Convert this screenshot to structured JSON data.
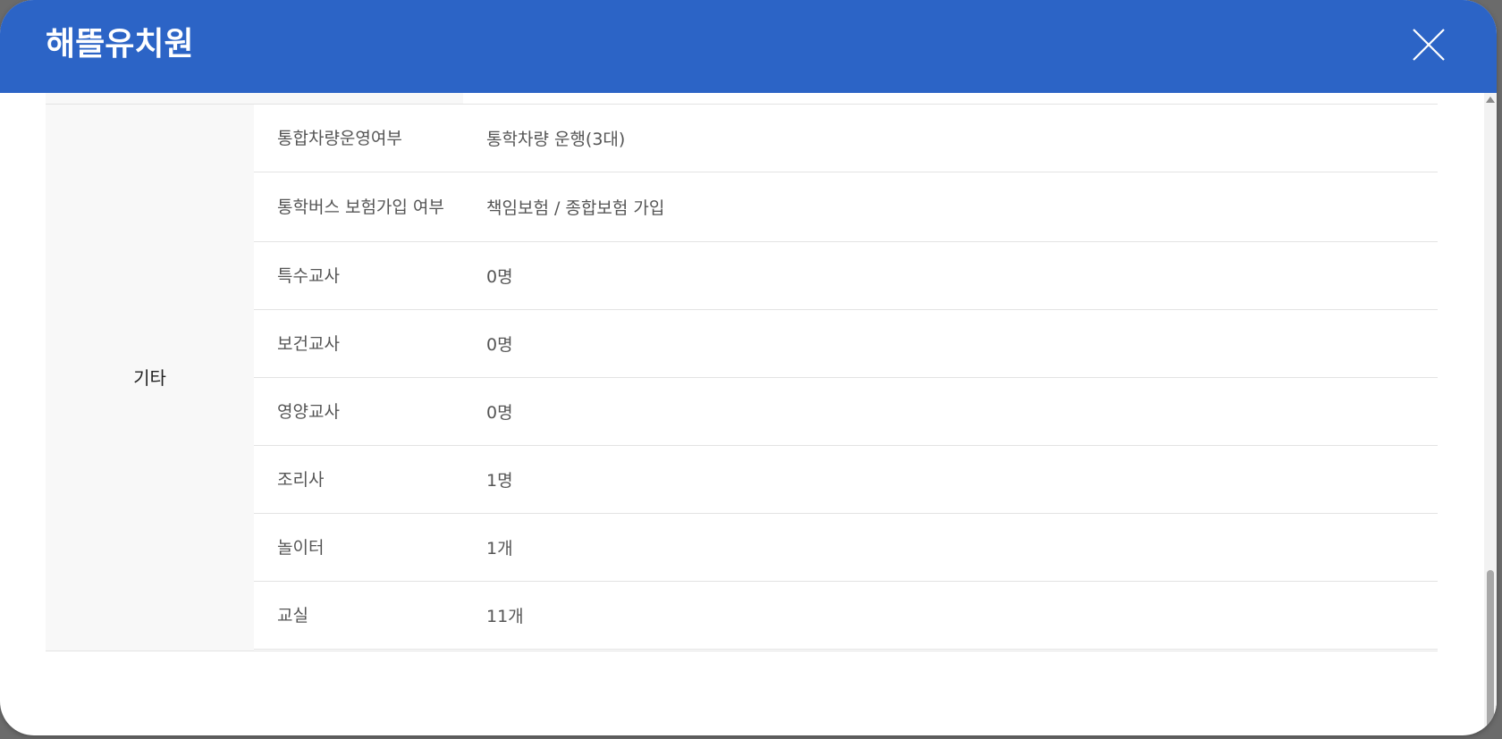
{
  "modal": {
    "title": "해뜰유치원",
    "close_icon": "close-icon",
    "header_color": "#2c64c6"
  },
  "section": {
    "group_label": "기타",
    "rows": [
      {
        "label": "통합차량운영여부",
        "value": "통학차량 운행(3대)"
      },
      {
        "label": "통학버스 보험가입 여부",
        "value": "책임보험 / 종합보험 가입"
      },
      {
        "label": "특수교사",
        "value": "0명"
      },
      {
        "label": "보건교사",
        "value": "0명"
      },
      {
        "label": "영양교사",
        "value": "0명"
      },
      {
        "label": "조리사",
        "value": "1명"
      },
      {
        "label": "놀이터",
        "value": "1개"
      },
      {
        "label": "교실",
        "value": "11개"
      }
    ]
  }
}
